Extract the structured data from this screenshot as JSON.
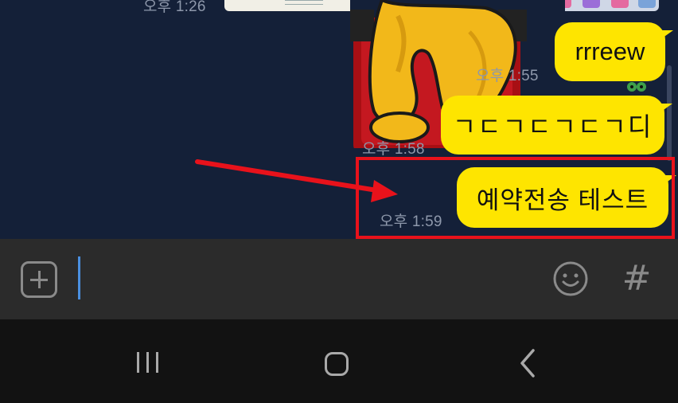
{
  "chat": {
    "messages": [
      {
        "time": "오후 1:26"
      },
      {
        "text": "rrreew",
        "time": "오후 1:55"
      },
      {
        "text": "ㄱㄷㄱㄷㄱㄷㄱ디",
        "time": "오후 1:58"
      },
      {
        "text": "예약전송 테스트",
        "time": "오후 1:59"
      }
    ],
    "bubble_color": "#fee500",
    "background_color": "#142038"
  },
  "annotation": {
    "color": "#e8121b"
  },
  "input_bar": {
    "add_icon": "plus-square-icon",
    "emoji_icon": "smiley-icon",
    "hash_label": "#"
  },
  "nav_bar": {
    "recent_icon": "recent-apps-icon",
    "home_icon": "home-icon",
    "back_icon": "back-icon"
  }
}
